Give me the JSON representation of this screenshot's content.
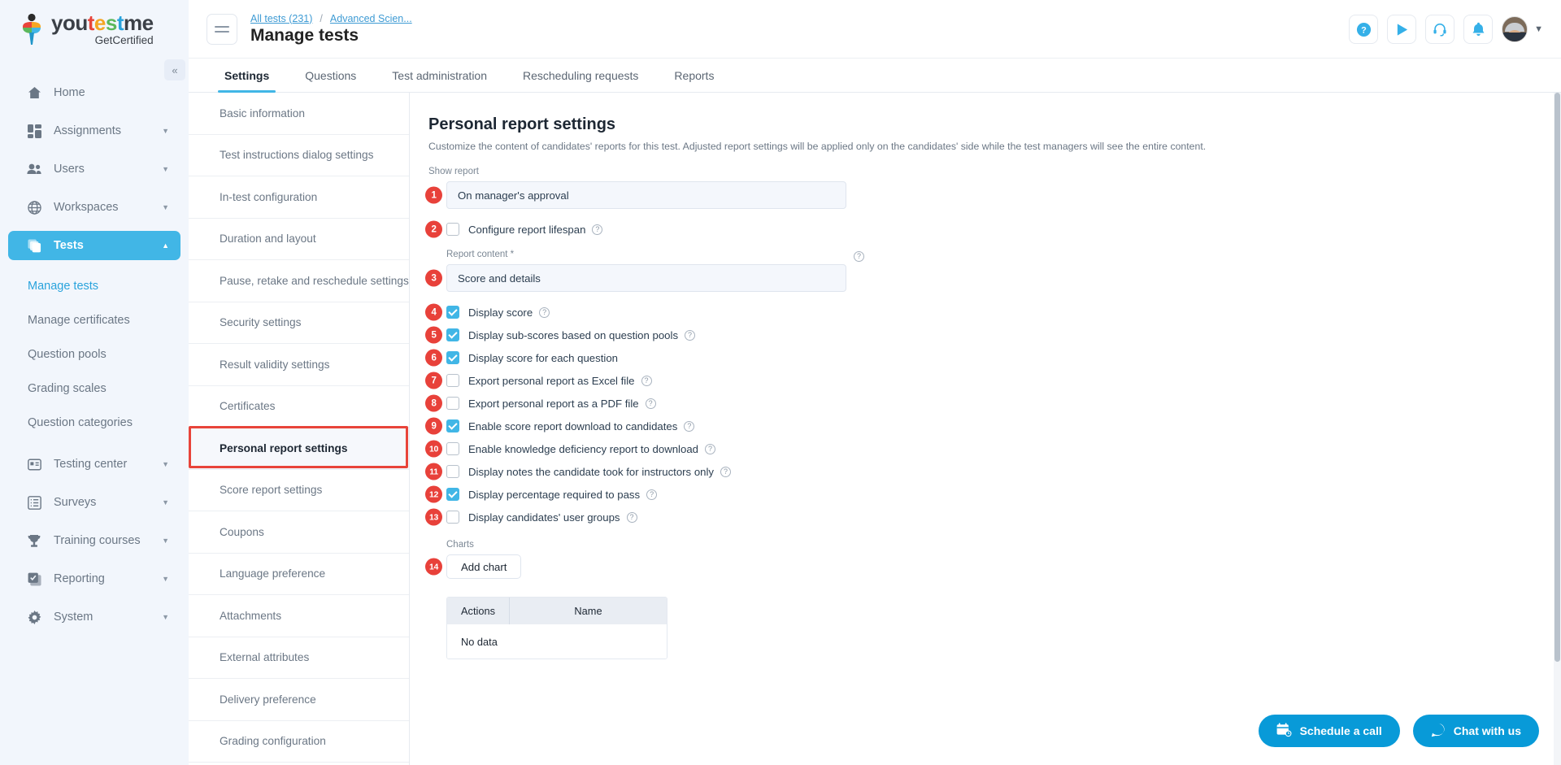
{
  "brand": {
    "name_parts": [
      "you",
      "t",
      "e",
      "s",
      "t",
      "me"
    ],
    "tagline": "GetCertified",
    "accent": "#41b6e6",
    "red": "#e8413a"
  },
  "sidebar": {
    "collapse_icon": "double-chevron-left-icon",
    "items": [
      {
        "label": "Home",
        "icon": "home-icon",
        "caret": false,
        "active": false
      },
      {
        "label": "Assignments",
        "icon": "grid-icon",
        "caret": true,
        "active": false
      },
      {
        "label": "Users",
        "icon": "users-icon",
        "caret": true,
        "active": false
      },
      {
        "label": "Workspaces",
        "icon": "globe-icon",
        "caret": true,
        "active": false
      },
      {
        "label": "Tests",
        "icon": "layers-icon",
        "caret": true,
        "active": true
      }
    ],
    "sub_items": [
      {
        "label": "Manage tests",
        "active": true
      },
      {
        "label": "Manage certificates",
        "active": false
      },
      {
        "label": "Question pools",
        "active": false
      },
      {
        "label": "Grading scales",
        "active": false
      },
      {
        "label": "Question categories",
        "active": false
      }
    ],
    "items_bottom": [
      {
        "label": "Testing center",
        "icon": "id-card-icon",
        "caret": true
      },
      {
        "label": "Surveys",
        "icon": "list-icon",
        "caret": true
      },
      {
        "label": "Training courses",
        "icon": "trophy-icon",
        "caret": true
      },
      {
        "label": "Reporting",
        "icon": "report-icon",
        "caret": true
      },
      {
        "label": "System",
        "icon": "gear-icon",
        "caret": true
      }
    ]
  },
  "topbar": {
    "menu_icon": "hamburger-icon",
    "breadcrumb": [
      {
        "label": "All tests (231)"
      },
      {
        "label": "Advanced Scien..."
      }
    ],
    "breadcrumb_separator": "/",
    "title": "Manage tests",
    "actions": [
      {
        "name": "help-icon"
      },
      {
        "name": "play-icon"
      },
      {
        "name": "headset-icon"
      },
      {
        "name": "bell-icon"
      }
    ],
    "avatar_caret": "chevron-down-icon"
  },
  "tabs": [
    {
      "label": "Settings",
      "active": true
    },
    {
      "label": "Questions",
      "active": false
    },
    {
      "label": "Test administration",
      "active": false
    },
    {
      "label": "Rescheduling requests",
      "active": false
    },
    {
      "label": "Reports",
      "active": false
    }
  ],
  "settings_menu": [
    {
      "label": "Basic information",
      "selected": false
    },
    {
      "label": "Test instructions dialog settings",
      "selected": false
    },
    {
      "label": "In-test configuration",
      "selected": false
    },
    {
      "label": "Duration and layout",
      "selected": false
    },
    {
      "label": "Pause, retake and reschedule settings",
      "selected": false
    },
    {
      "label": "Security settings",
      "selected": false
    },
    {
      "label": "Result validity settings",
      "selected": false
    },
    {
      "label": "Certificates",
      "selected": false
    },
    {
      "label": "Personal report settings",
      "selected": true
    },
    {
      "label": "Score report settings",
      "selected": false
    },
    {
      "label": "Coupons",
      "selected": false
    },
    {
      "label": "Language preference",
      "selected": false
    },
    {
      "label": "Attachments",
      "selected": false
    },
    {
      "label": "External attributes",
      "selected": false
    },
    {
      "label": "Delivery preference",
      "selected": false
    },
    {
      "label": "Grading configuration",
      "selected": false
    }
  ],
  "panel": {
    "title": "Personal report settings",
    "description": "Customize the content of candidates' reports for this test. Adjusted report settings will be applied only on the candidates' side while the test managers will see the entire content.",
    "show_report_label": "Show report",
    "show_report_value": "On manager's approval",
    "show_report_badge": "1",
    "lifespan_label": "Configure report lifespan",
    "lifespan_badge": "2",
    "lifespan_checked": false,
    "report_content_label": "Report content",
    "report_content_required": "*",
    "report_content_value": "Score and details",
    "report_content_badge": "3",
    "checkboxes": [
      {
        "badge": "4",
        "label": "Display score",
        "checked": true,
        "help": true
      },
      {
        "badge": "5",
        "label": "Display sub-scores based on question pools",
        "checked": true,
        "help": true
      },
      {
        "badge": "6",
        "label": "Display score for each question",
        "checked": true,
        "help": false
      },
      {
        "badge": "7",
        "label": "Export personal report as Excel file",
        "checked": false,
        "help": true
      },
      {
        "badge": "8",
        "label": "Export personal report as a PDF file",
        "checked": false,
        "help": true
      },
      {
        "badge": "9",
        "label": "Enable score report download to candidates",
        "checked": true,
        "help": true
      },
      {
        "badge": "10",
        "label": "Enable knowledge deficiency report to download",
        "checked": false,
        "help": true
      },
      {
        "badge": "11",
        "label": "Display notes the candidate took for instructors only",
        "checked": false,
        "help": true
      },
      {
        "badge": "12",
        "label": "Display percentage required to pass",
        "checked": true,
        "help": true
      },
      {
        "badge": "13",
        "label": "Display candidates' user groups",
        "checked": false,
        "help": true
      }
    ],
    "charts_label": "Charts",
    "add_chart_label": "Add chart",
    "add_chart_badge": "14",
    "table": {
      "columns": [
        "Actions",
        "Name"
      ],
      "empty_text": "No data"
    }
  },
  "floating": [
    {
      "label": "Schedule a call",
      "icon": "calendar-clock-icon"
    },
    {
      "label": "Chat with us",
      "icon": "chat-bubble-icon"
    }
  ]
}
